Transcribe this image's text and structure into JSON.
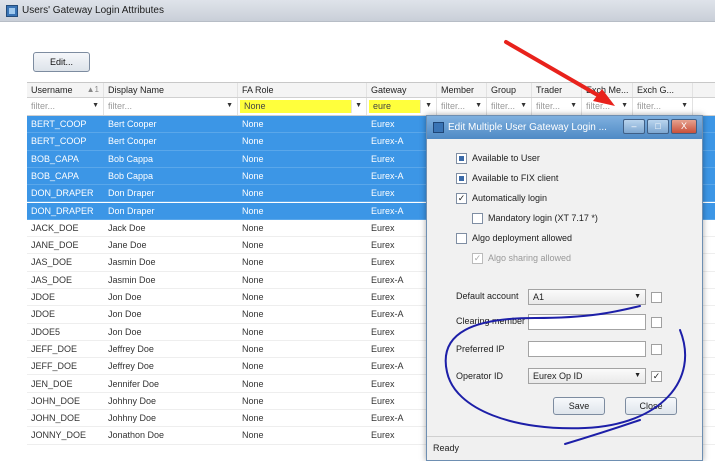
{
  "window": {
    "title": "Users' Gateway Login Attributes"
  },
  "toolbar": {
    "edit_label": "Edit..."
  },
  "grid": {
    "columns": [
      "Username",
      "Display Name",
      "FA Role",
      "Gateway",
      "Member",
      "Group",
      "Trader",
      "Exch Me...",
      "Exch G..."
    ],
    "sort_indicator": "▲1",
    "filters": [
      "filter...",
      "filter...",
      "None",
      "eure",
      "filter...",
      "filter...",
      "filter...",
      "filter...",
      "filter..."
    ],
    "rows": [
      [
        "BERT_COOP",
        "Bert Cooper",
        "None",
        "Eurex"
      ],
      [
        "BERT_COOP",
        "Bert Cooper",
        "None",
        "Eurex-A"
      ],
      [
        "BOB_CAPA",
        "Bob Cappa",
        "None",
        "Eurex"
      ],
      [
        "BOB_CAPA",
        "Bob Cappa",
        "None",
        "Eurex-A"
      ],
      [
        "DON_DRAPER",
        "Don Draper",
        "None",
        "Eurex"
      ],
      [
        "DON_DRAPER",
        "Don Draper",
        "None",
        "Eurex-A"
      ],
      [
        "JACK_DOE",
        "Jack Doe",
        "None",
        "Eurex"
      ],
      [
        "JANE_DOE",
        "Jane Doe",
        "None",
        "Eurex"
      ],
      [
        "JAS_DOE",
        "Jasmin Doe",
        "None",
        "Eurex"
      ],
      [
        "JAS_DOE",
        "Jasmin Doe",
        "None",
        "Eurex-A"
      ],
      [
        "JDOE",
        "Jon Doe",
        "None",
        "Eurex"
      ],
      [
        "JDOE",
        "Jon Doe",
        "None",
        "Eurex-A"
      ],
      [
        "JDOE5",
        "Jon Doe",
        "None",
        "Eurex"
      ],
      [
        "JEFF_DOE",
        "Jeffrey Doe",
        "None",
        "Eurex"
      ],
      [
        "JEFF_DOE",
        "Jeffrey Doe",
        "None",
        "Eurex-A"
      ],
      [
        "JEN_DOE",
        "Jennifer Doe",
        "None",
        "Eurex"
      ],
      [
        "JOHN_DOE",
        "Johhny Doe",
        "None",
        "Eurex"
      ],
      [
        "JOHN_DOE",
        "Johhny Doe",
        "None",
        "Eurex-A"
      ],
      [
        "JONNY_DOE",
        "Jonathon Doe",
        "None",
        "Eurex"
      ]
    ],
    "selected_rows": 6
  },
  "dialog": {
    "title": "Edit Multiple User Gateway Login ...",
    "buttons": {
      "minimize": "–",
      "maximize": "□",
      "close": "X"
    },
    "checkboxes": [
      {
        "label": "Available to User",
        "state": "indeterminate"
      },
      {
        "label": "Available to FIX client",
        "state": "indeterminate"
      },
      {
        "label": "Automatically login",
        "state": "checked"
      },
      {
        "label": "Mandatory login (XT 7.17 *)",
        "state": "unchecked"
      },
      {
        "label": "Algo deployment allowed",
        "state": "unchecked"
      },
      {
        "label": "Algo sharing allowed",
        "state": "checked-disabled"
      }
    ],
    "fields": {
      "default_account": {
        "label": "Default account",
        "value": "A1"
      },
      "clearing_member": {
        "label": "Clearing member",
        "value": ""
      },
      "preferred_ip": {
        "label": "Preferred IP",
        "value": ""
      },
      "operator_id": {
        "label": "Operator ID",
        "value": "Eurex Op ID"
      }
    },
    "save_label": "Save",
    "close_label": "Close",
    "status": "Ready"
  },
  "annotation_colors": {
    "arrow": "#e8221c",
    "circle": "#1d1fa8"
  }
}
